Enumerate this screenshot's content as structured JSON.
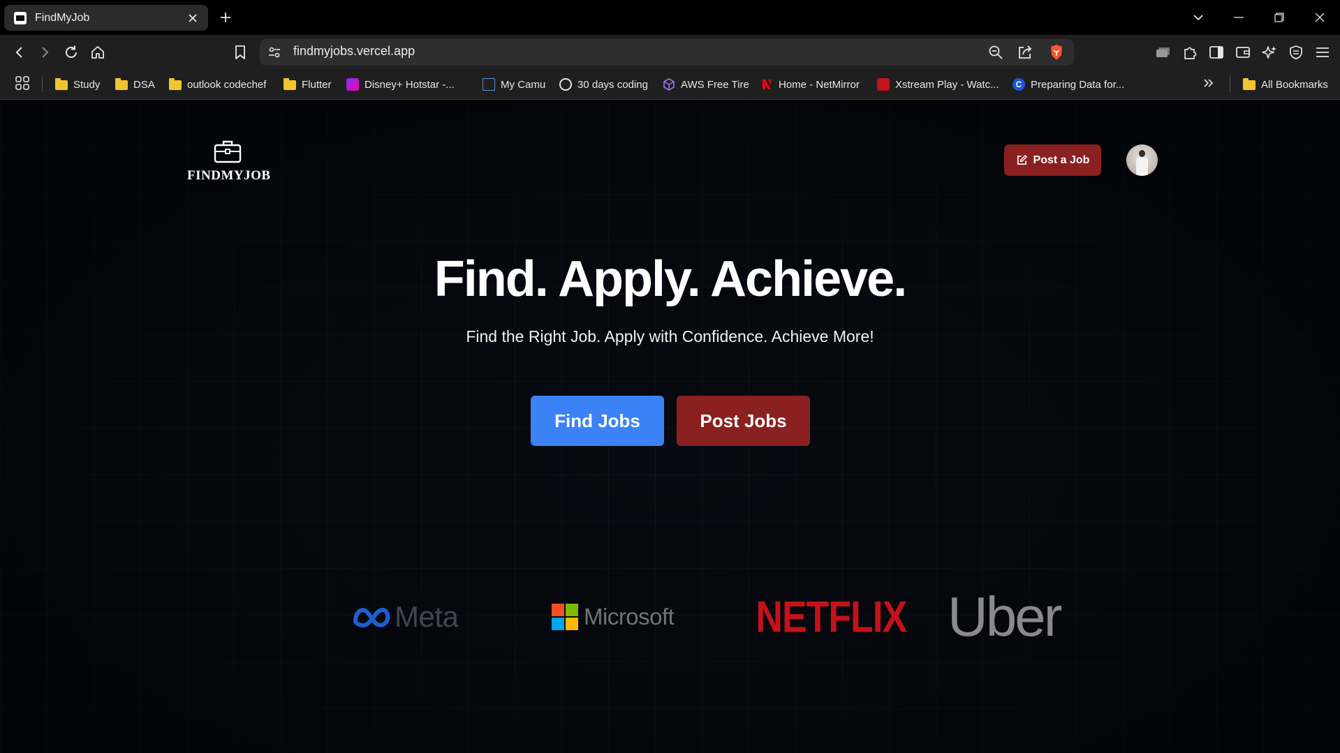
{
  "browser": {
    "tab_title": "FindMyJob",
    "url": "findmyjobs.vercel.app",
    "bookmarks": [
      {
        "label": "Study",
        "icon": "folder-icon"
      },
      {
        "label": "DSA",
        "icon": "folder-icon"
      },
      {
        "label": "outlook codechef",
        "icon": "folder-icon"
      },
      {
        "label": "Flutter",
        "icon": "folder-icon"
      },
      {
        "label": "Disney+ Hotstar -...",
        "icon": "hotstar-icon"
      },
      {
        "label": "My Camu",
        "icon": "camu-icon"
      },
      {
        "label": "30 days coding",
        "icon": "globe-icon"
      },
      {
        "label": "AWS Free Tire",
        "icon": "aws-icon"
      },
      {
        "label": "Home - NetMirror",
        "icon": "netmirror-icon"
      },
      {
        "label": "Xstream Play - Watc...",
        "icon": "xstream-icon"
      },
      {
        "label": "Preparing Data for...",
        "icon": "c-icon"
      }
    ],
    "all_bookmarks_label": "All Bookmarks",
    "colors": {
      "tab_bg": "#2b2b2b",
      "toolbar_bg": "#1f1f1f",
      "brave_orange": "#fb542b"
    }
  },
  "header": {
    "logo_text": "FINDMYJOB",
    "post_job_label": "Post a Job"
  },
  "hero": {
    "headline": "Find. Apply. Achieve.",
    "subheadline": "Find the Right Job. Apply with Confidence. Achieve More!",
    "find_jobs_label": "Find Jobs",
    "post_jobs_label": "Post Jobs"
  },
  "brands": {
    "meta": "Meta",
    "microsoft": "Microsoft",
    "netflix": "NETFLIX",
    "uber": "Uber"
  },
  "colors": {
    "primary_blue": "#3b82f6",
    "accent_red": "#8b2020",
    "netflix_red": "#e50914",
    "page_bg": "#070a12"
  }
}
